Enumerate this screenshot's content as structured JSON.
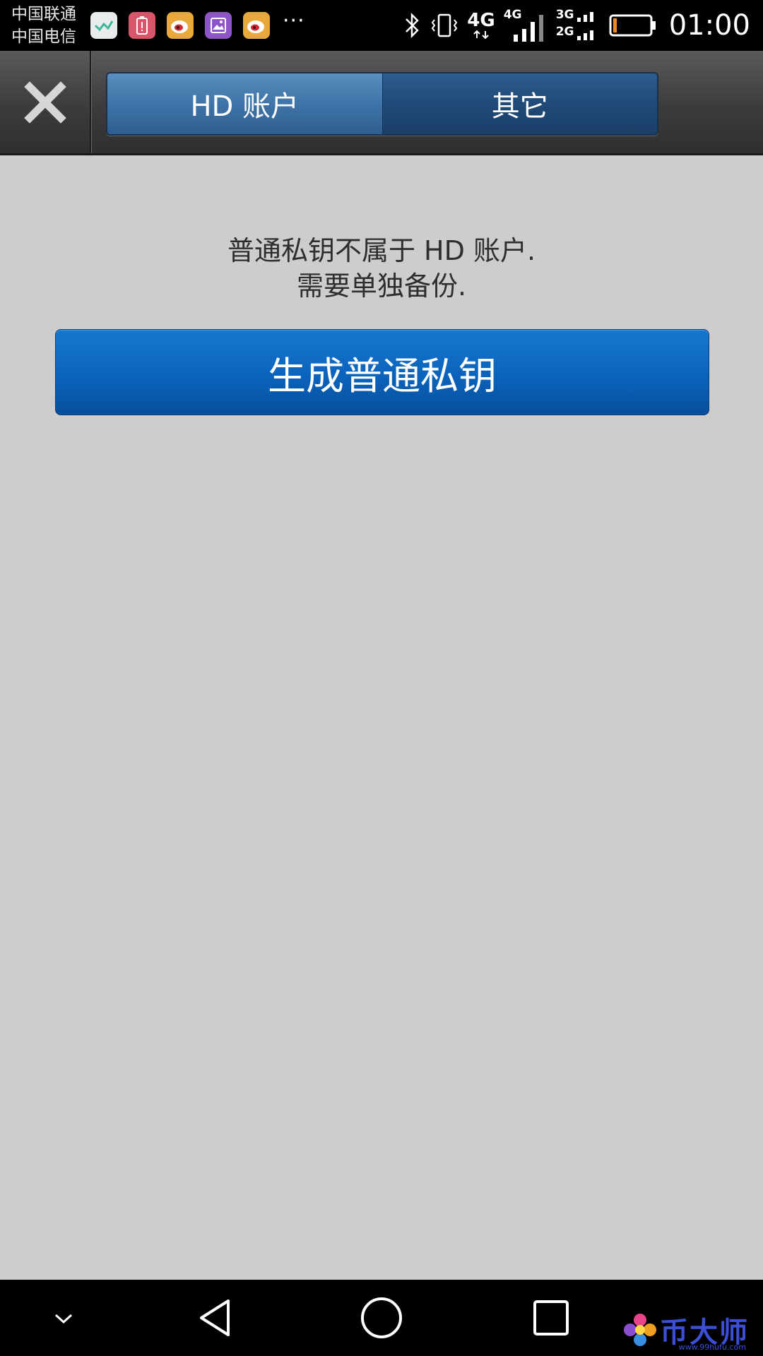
{
  "status_bar": {
    "carrier_1": "中国联通",
    "carrier_2": "中国电信",
    "notification_more": "···",
    "network_1": "4G",
    "network_2": "4G",
    "network_3a": "3G",
    "network_3b": "2G",
    "time": "01:00",
    "notification_icons": [
      "check-app-icon",
      "battery-alert-icon",
      "weibo-icon",
      "gallery-icon",
      "weibo-icon"
    ],
    "battery_level_percent": 10
  },
  "header": {
    "close_icon": "close-icon",
    "tabs": [
      {
        "label": "HD 账户",
        "active": true
      },
      {
        "label": "其它",
        "active": false
      }
    ]
  },
  "content": {
    "message_line_1": "普通私钥不属于 HD 账户.",
    "message_line_2": "需要单独备份.",
    "generate_button_label": "生成普通私钥"
  },
  "watermark": {
    "text": "币大师",
    "url": "www.99hufu.com"
  },
  "colors": {
    "header_dark": "#3c3c3c",
    "tab_active": "#3f74a8",
    "tab_inactive": "#204a78",
    "button_blue": "#0a63bc",
    "background": "#cdcdcd"
  }
}
